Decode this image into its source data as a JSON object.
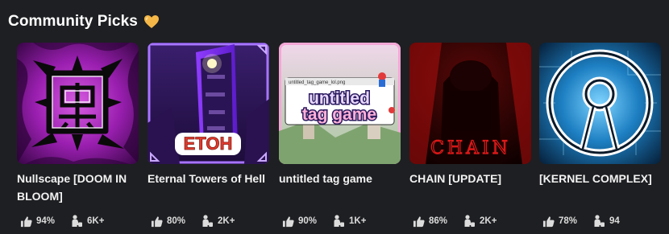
{
  "section": {
    "title": "Community Picks",
    "title_icon": "heart-icon",
    "heart_color": "#f5b747"
  },
  "games": [
    {
      "title": "Nullscape [DOOM IN BLOOM]",
      "like_ratio": "94%",
      "players": "6K+",
      "accent": "#b01ecd"
    },
    {
      "title": "Eternal Towers of Hell",
      "like_ratio": "80%",
      "players": "2K+",
      "accent": "#8a2be2",
      "thumb_text": "ETOH"
    },
    {
      "title": "untitled tag game",
      "like_ratio": "90%",
      "players": "1K+",
      "accent": "#d24aa8",
      "thumb_text_1": "untitled",
      "thumb_text_2": "tag game",
      "thumb_window_title": "untitled_tag_game_lol.png"
    },
    {
      "title": "CHAIN [UPDATE]",
      "like_ratio": "86%",
      "players": "2K+",
      "accent": "#c41414",
      "thumb_text": "CHAIN"
    },
    {
      "title": "[KERNEL COMPLEX]",
      "like_ratio": "78%",
      "players": "94",
      "accent": "#3fa7e0"
    }
  ],
  "icons": {
    "like": "thumbs-up-icon",
    "players": "players-icon"
  }
}
